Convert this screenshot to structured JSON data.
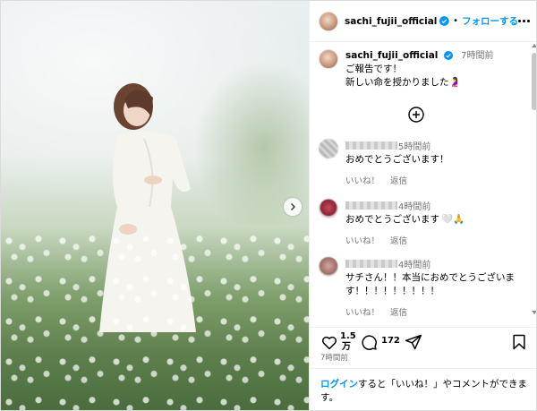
{
  "header": {
    "username": "sachi_fujii_official",
    "separator": "•",
    "follow_label": "フォローする"
  },
  "caption": {
    "username": "sachi_fujii_official",
    "time": "7時間前",
    "line1": "ご報告です！",
    "line2": "新しい命を授かりました",
    "emoji": "🤰"
  },
  "comments": [
    {
      "time": "5時間前",
      "text": "おめでとうございます！",
      "like_label": "いいね！",
      "reply_label": "返信"
    },
    {
      "time": "4時間前",
      "text": "おめでとうございます",
      "emoji": "🤍🙏",
      "like_label": "いいね！",
      "reply_label": "返信"
    },
    {
      "time": "4時間前",
      "text": "サチさん！！本当におめでとうございます！！！！！！！！！",
      "like_label": "いいね！",
      "reply_label": "返信"
    }
  ],
  "actions": {
    "like_count_line1": "1.5",
    "like_count_line2": "万",
    "comment_count": "172",
    "post_time": "7時間前"
  },
  "footer": {
    "login_link": "ログイン",
    "rest": "すると「いいね！」やコメントができます。"
  },
  "colors": {
    "accent": "#0095f6",
    "muted": "#737373",
    "border": "#efefef"
  },
  "icons": [
    "verified-badge-icon",
    "more-options-icon",
    "add-comment-icon",
    "heart-icon",
    "comment-icon",
    "share-icon",
    "bookmark-icon",
    "next-arrow-icon"
  ]
}
